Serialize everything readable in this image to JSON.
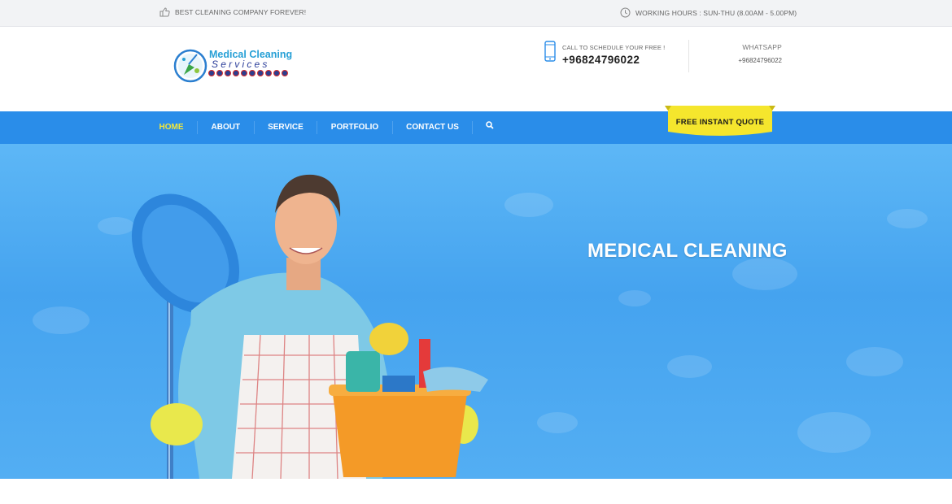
{
  "topbar": {
    "tagline": "BEST CLEANING COMPANY FOREVER!",
    "hours": "WORKING HOURS : SUN-THU (8.00AM - 5.00PM)"
  },
  "header": {
    "logo": {
      "line1": "Medical Cleaning",
      "line2": "Services"
    },
    "call": {
      "caption": "CALL TO SCHEDULE YOUR FREE !",
      "number": "+96824796022"
    },
    "whatsapp": {
      "caption": "WHATSAPP",
      "number": "+96824796022"
    }
  },
  "nav": {
    "items": [
      {
        "label": "HOME",
        "active": true
      },
      {
        "label": "ABOUT"
      },
      {
        "label": "SERVICE"
      },
      {
        "label": "PORTFOLIO"
      },
      {
        "label": "CONTACT US"
      }
    ],
    "quote_label": "FREE INSTANT QUOTE"
  },
  "hero": {
    "title": "MEDICAL CLEANING"
  },
  "colors": {
    "nav_bg": "#2a8de9",
    "active_nav": "#f2e73b",
    "quote_bg": "#f5e62d",
    "hero_blue": "#4aa8f1"
  },
  "icons": {
    "tagline": "thumbs-up-icon",
    "hours": "clock-icon",
    "call": "mobile-phone-icon",
    "search": "search-icon"
  }
}
